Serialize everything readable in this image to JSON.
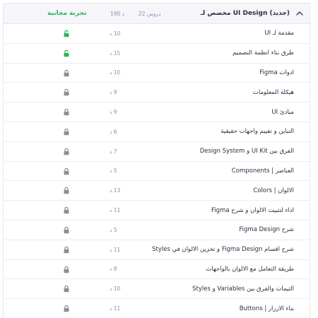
{
  "section": {
    "title": "مخصص لـ UI Design (جديد)",
    "lessons_count": "22 دروس",
    "duration": "190 د",
    "free_label": "تجربة مجانية"
  },
  "colors": {
    "accent_green": "#2fb35c",
    "lock_gray": "#8d8d94"
  },
  "lessons": [
    {
      "title": "مقدمة لـ UI",
      "duration": "10 د",
      "unlocked": true
    },
    {
      "title": "طرق بناء انظمة التصميم",
      "duration": "15 د",
      "unlocked": true
    },
    {
      "title": "ادوات Figma",
      "duration": "10 د",
      "unlocked": false
    },
    {
      "title": "هيكلة المعلومات",
      "duration": "9 د",
      "unlocked": false
    },
    {
      "title": "مبادئ UI",
      "duration": "9 د",
      "unlocked": false
    },
    {
      "title": "التباين و تقييم واجهات حقيقية",
      "duration": "6 د",
      "unlocked": false
    },
    {
      "title": "الفرق بين UI Kit و Design System",
      "duration": "7 د",
      "unlocked": false
    },
    {
      "title": "العناصر | Components",
      "duration": "5 د",
      "unlocked": false
    },
    {
      "title": "الالوان | Colors",
      "duration": "13 د",
      "unlocked": false
    },
    {
      "title": "اداء لتثبيت الالوان و شرح Figma",
      "duration": "11 د",
      "unlocked": false
    },
    {
      "title": "شرح Figma Design",
      "duration": "5 د",
      "unlocked": false
    },
    {
      "title": "شرح اقسام Figma Design و تخزين الالوان في Styles",
      "duration": "11 د",
      "unlocked": false
    },
    {
      "title": "طريقة التعامل مع الالوان بالواجهات",
      "duration": "8 د",
      "unlocked": false
    },
    {
      "title": "الثيمات والفرق بين Variables و Styles",
      "duration": "10 د",
      "unlocked": false
    },
    {
      "title": "بناء الازرار | Buttons",
      "duration": "11 د",
      "unlocked": false
    }
  ]
}
